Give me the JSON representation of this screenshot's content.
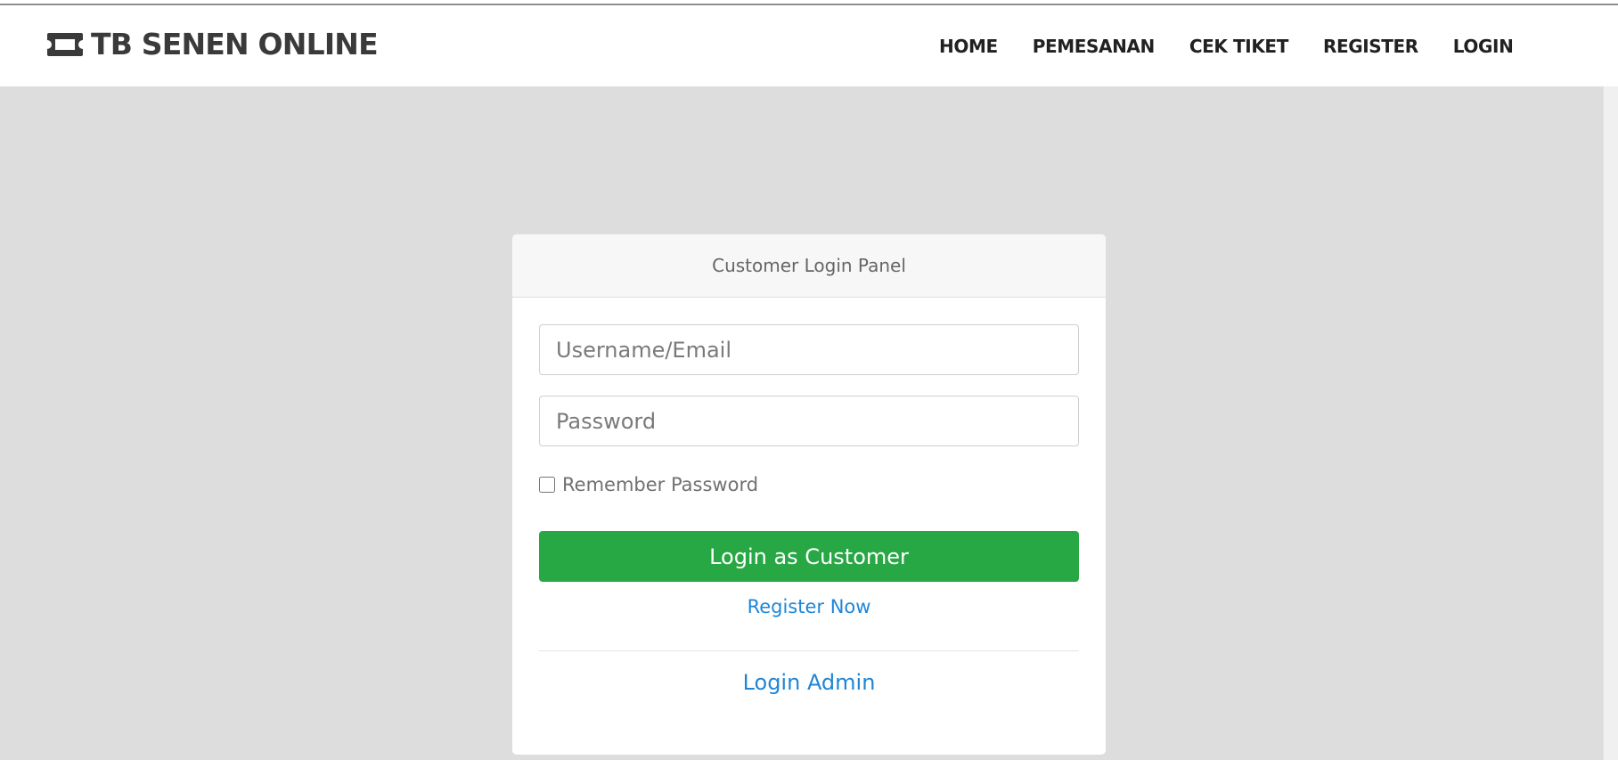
{
  "header": {
    "brand_icon": "ticket-icon",
    "brand_text": "TB SENEN ONLINE",
    "nav": [
      {
        "label": "HOME"
      },
      {
        "label": "PEMESANAN"
      },
      {
        "label": "CEK TIKET"
      },
      {
        "label": "REGISTER"
      },
      {
        "label": "LOGIN"
      }
    ]
  },
  "login_panel": {
    "title": "Customer Login Panel",
    "username_placeholder": "Username/Email",
    "username_value": "",
    "password_placeholder": "Password",
    "password_value": "",
    "remember_label": "Remember Password",
    "remember_checked": false,
    "submit_label": "Login as Customer",
    "register_link": "Register Now",
    "admin_link": "Login Admin"
  },
  "colors": {
    "background": "#dddddd",
    "brand_text": "#3a3a3a",
    "primary_button": "#28a745",
    "link": "#1e86d8"
  }
}
